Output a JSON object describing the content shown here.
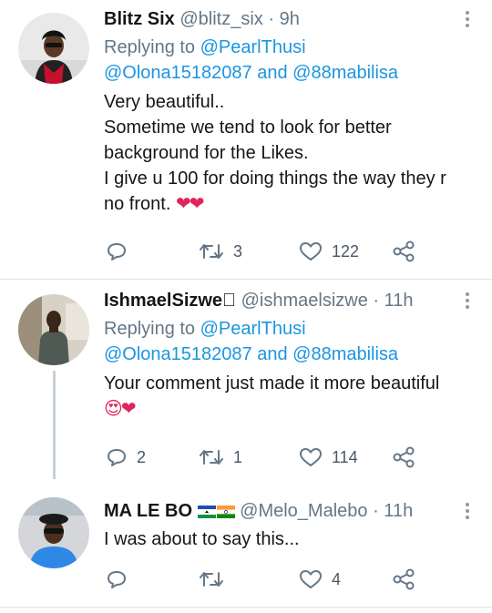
{
  "tweets": [
    {
      "name": "Blitz Six",
      "handle": "@blitz_six",
      "time": "· 9h",
      "replying_prefix": "Replying to ",
      "replying_to_1": "@PearlThusi",
      "replying_to_2": "@Olona15182087",
      "replying_and": " and ",
      "replying_to_3": "@88mabilisa",
      "text_lines": [
        "Very beautiful..",
        "Sometime we tend to look for better",
        "background for the Likes.",
        "I give u 100 for doing things the way they r",
        "no front."
      ],
      "emoji": "❤❤",
      "reply_count": "",
      "retweet_count": "3",
      "like_count": "122"
    },
    {
      "name": "IshmaelSizwe",
      "name_badge": "⃞",
      "handle": "@ishmaelsizwe",
      "time": "· 11h",
      "replying_prefix": "Replying to ",
      "replying_to_1": "@PearlThusi",
      "replying_to_2": "@Olona15182087",
      "replying_and": " and ",
      "replying_to_3": "@88mabilisa",
      "text_lines": [
        "Your comment just made it more beautiful"
      ],
      "emoji": "😍❤",
      "reply_count": "2",
      "retweet_count": "1",
      "like_count": "114"
    },
    {
      "name": "MA LE BO",
      "handle": "@Melo_Malebo",
      "time": "· 11h",
      "text_lines": [
        "I was about to say this..."
      ],
      "reply_count": "",
      "retweet_count": "",
      "like_count": "4"
    }
  ],
  "icons": {
    "reply": "reply-icon",
    "retweet": "retweet-icon",
    "like": "heart-icon",
    "share": "share-icon",
    "more": "more-vertical-icon"
  },
  "colors": {
    "link": "#1b95e0",
    "meta": "#657786",
    "heart": "#e0245e",
    "divider": "#dfe4e8"
  }
}
